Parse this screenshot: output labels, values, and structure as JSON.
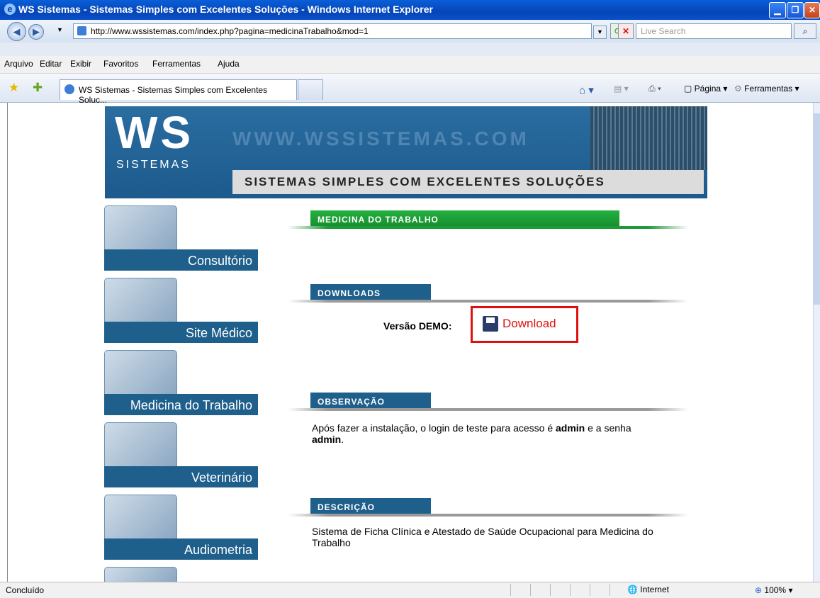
{
  "window": {
    "title": "WS Sistemas - Sistemas Simples com Excelentes Soluções - Windows Internet Explorer"
  },
  "address": {
    "url": "http://www.wssistemas.com/index.php?pagina=medicinaTrabalho&mod=1",
    "search_placeholder": "Live Search"
  },
  "menu": [
    "Arquivo",
    "Editar",
    "Exibir",
    "Favoritos",
    "Ferramentas",
    "Ajuda"
  ],
  "tab": {
    "title": "WS Sistemas - Sistemas Simples com Excelentes Soluç..."
  },
  "toolbar": {
    "page_label": "Página",
    "tools_label": "Ferramentas"
  },
  "banner": {
    "logo": "WS",
    "logo_sub": "SISTEMAS",
    "url_text": "WWW.WSSISTEMAS.COM",
    "slogan": "SISTEMAS SIMPLES COM EXCELENTES SOLUÇÕES"
  },
  "sidebar": {
    "items": [
      {
        "label": "Consultório"
      },
      {
        "label": "Site Médico"
      },
      {
        "label": "Medicina do Trabalho"
      },
      {
        "label": "Veterinário"
      },
      {
        "label": "Audiometria"
      }
    ]
  },
  "main": {
    "page_header": "MEDICINA DO TRABALHO",
    "downloads": {
      "header": "DOWNLOADS",
      "demo_label": "Versão DEMO:",
      "download_label": "Download"
    },
    "observacao": {
      "header": "OBSERVAÇÃO",
      "text_before": "Após fazer a instalação, o login de teste para acesso é ",
      "bold1": "admin",
      "text_mid": " e a senha ",
      "bold2": "admin",
      "text_after": "."
    },
    "descricao": {
      "header": "DESCRIÇÃO",
      "text": "Sistema de Ficha Clínica e Atestado de Saúde Ocupacional para Medicina do Trabalho"
    }
  },
  "status": {
    "left": "Concluído",
    "zone": "Internet",
    "zoom": "100%"
  },
  "colors": {
    "section_blue": "#1f5f8c",
    "section_green": "#1e9a36",
    "download_red": "#e01010"
  }
}
